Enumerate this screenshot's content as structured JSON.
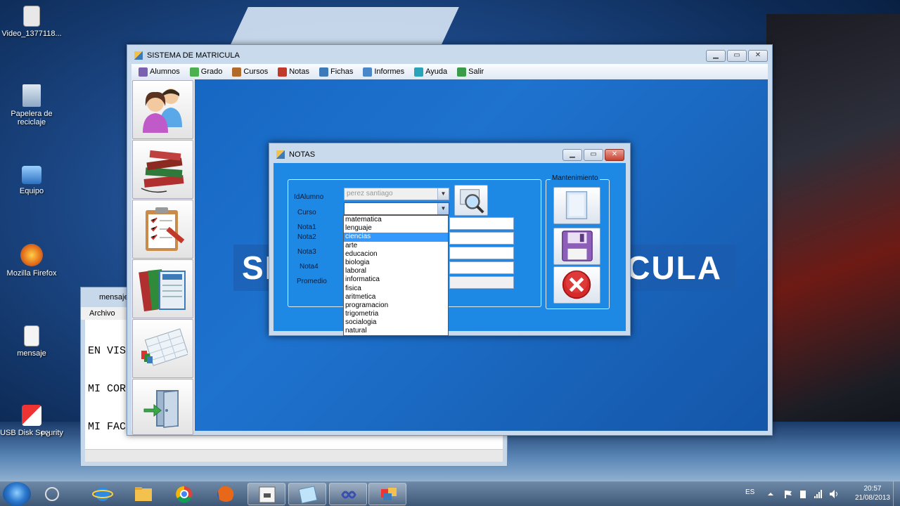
{
  "desktop": {
    "icons": [
      {
        "label": "Video_1377118...",
        "name": "video-file-icon"
      },
      {
        "label": "Papelera de reciclaje",
        "name": "recycle-bin-icon"
      },
      {
        "label": "Equipo",
        "name": "computer-icon"
      },
      {
        "label": "Mozilla Firefox",
        "name": "firefox-icon"
      },
      {
        "label": "mensaje",
        "name": "text-file-icon"
      },
      {
        "label": "USB Disk Security",
        "name": "usb-security-icon"
      }
    ],
    "partial_icon_label": "Po"
  },
  "notepad": {
    "title": "mensaje",
    "menu": "Archivo",
    "lines": [
      "EN VIS",
      "MI COR",
      "MI FAC"
    ]
  },
  "main_window": {
    "title": "SISTEMA DE MATRICULA",
    "menu": [
      {
        "label": "Alumnos",
        "icon": "students-icon",
        "color": "#7b5fb0"
      },
      {
        "label": "Grado",
        "icon": "grade-icon",
        "color": "#4caf50"
      },
      {
        "label": "Cursos",
        "icon": "courses-icon",
        "color": "#b06a2a"
      },
      {
        "label": "Notas",
        "icon": "notes-icon",
        "color": "#c0392b"
      },
      {
        "label": "Fichas",
        "icon": "forms-icon",
        "color": "#3d7ab8"
      },
      {
        "label": "Informes",
        "icon": "reports-icon",
        "color": "#4a87c9"
      },
      {
        "label": "Ayuda",
        "icon": "help-icon",
        "color": "#2aa3b8"
      },
      {
        "label": "Salir",
        "icon": "exit-icon",
        "color": "#3a9c4a"
      }
    ],
    "sidebar": [
      {
        "name": "sidebar-students-button",
        "icon": "people-icon"
      },
      {
        "name": "sidebar-books-button",
        "icon": "books-icon"
      },
      {
        "name": "sidebar-clipboard-button",
        "icon": "clipboard-icon"
      },
      {
        "name": "sidebar-records-button",
        "icon": "records-icon"
      },
      {
        "name": "sidebar-report-button",
        "icon": "spreadsheet-icon"
      },
      {
        "name": "sidebar-exit-button",
        "icon": "exit-door-icon"
      }
    ],
    "banner_left": "SI",
    "banner_right": "CULA"
  },
  "dialog": {
    "title": "NOTAS",
    "labels": {
      "idalumno": "IdAlumno",
      "curso": "Curso",
      "nota1": "Nota1",
      "nota2": "Nota2",
      "nota3": "Nota3",
      "nota4": "Nota4",
      "promedio": "Promedio"
    },
    "idalumno_value": "perez santiago",
    "curso_value": "",
    "maintenance_legend": "Mantenimiento",
    "course_options": [
      "matematica",
      "lenguaje",
      "ciencias",
      "arte",
      "educacion",
      "biologia",
      "laboral",
      "informatica",
      "fisica",
      "aritmetica",
      "programacion",
      "trigometria",
      "socialogia",
      "natural"
    ],
    "highlighted_option": "ciencias"
  },
  "taskbar": {
    "language": "ES",
    "time": "20:57",
    "date": "21/08/2013"
  },
  "colors": {
    "client_blue": "#1e73cf",
    "dialog_blue": "#1e88e5",
    "selection": "#3399ff"
  }
}
